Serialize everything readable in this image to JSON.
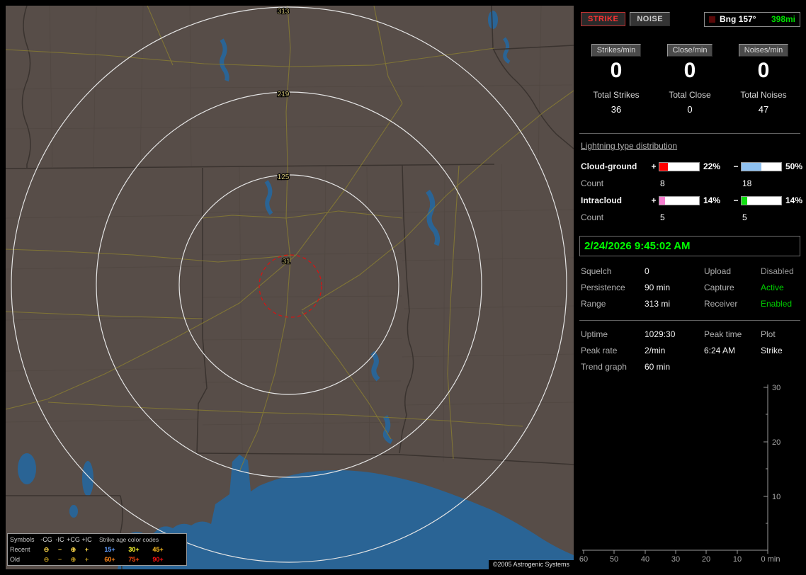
{
  "map": {
    "ring_labels": [
      "313",
      "219",
      "125",
      "31"
    ],
    "copyright": "©2005 Astrogenic Systems",
    "legend": {
      "symbols_title": "Symbols",
      "polarity_headers": [
        "-CG",
        "-IC",
        "+CG",
        "+IC"
      ],
      "age_title": "Strike age color codes",
      "recent_label": "Recent",
      "old_label": "Old",
      "recent_symbols": [
        "⊖",
        "−",
        "⊕",
        "+"
      ],
      "old_symbols": [
        "⊖",
        "−",
        "⊕",
        "+"
      ],
      "recent_symbol_color": "#ffd94a",
      "old_symbol_color": "#b08f1e",
      "recent_ages": [
        {
          "text": "15+",
          "color": "#5f9dff"
        },
        {
          "text": "30+",
          "color": "#ffff30"
        },
        {
          "text": "45+",
          "color": "#ffc020"
        }
      ],
      "old_ages": [
        {
          "text": "60+",
          "color": "#ff8518"
        },
        {
          "text": "75+",
          "color": "#ff4a10"
        },
        {
          "text": "90+",
          "color": "#ff1010"
        }
      ]
    }
  },
  "panel": {
    "strike_button": "STRIKE",
    "noise_button": "NOISE",
    "strike_color": "#ff3232",
    "bearing": {
      "label": "Bng 157°",
      "value": "398mi",
      "value_color": "#00e000"
    },
    "rates": [
      {
        "label": "Strikes/min",
        "value": "0"
      },
      {
        "label": "Close/min",
        "value": "0"
      },
      {
        "label": "Noises/min",
        "value": "0"
      }
    ],
    "totals": [
      {
        "label": "Total Strikes",
        "value": "36"
      },
      {
        "label": "Total Close",
        "value": "0"
      },
      {
        "label": "Total Noises",
        "value": "47"
      }
    ],
    "distribution": {
      "title": "Lightning type distribution",
      "count_label": "Count",
      "rows": [
        {
          "label": "Cloud-ground",
          "plus": {
            "sign": "+",
            "pct": "22%",
            "fill": 22,
            "color": "#ff0000",
            "count": "8"
          },
          "minus": {
            "sign": "−",
            "pct": "50%",
            "fill": 50,
            "color": "#8fc1f0",
            "count": "18"
          }
        },
        {
          "label": "Intracloud",
          "plus": {
            "sign": "+",
            "pct": "14%",
            "fill": 14,
            "color": "#f77fd0",
            "count": "5"
          },
          "minus": {
            "sign": "−",
            "pct": "14%",
            "fill": 14,
            "color": "#10e010",
            "count": "5"
          }
        }
      ]
    },
    "datetime": {
      "text": "2/24/2026 9:45:02 AM",
      "color": "#00ff00"
    },
    "settings": [
      {
        "label": "Squelch",
        "value": "0",
        "label2": "Upload",
        "value2": "Disabled",
        "value2_color": "#9a9a9a"
      },
      {
        "label": "Persistence",
        "value": "90 min",
        "label2": "Capture",
        "value2": "Active",
        "value2_color": "#00d000"
      },
      {
        "label": "Range",
        "value": "313 mi",
        "label2": "Receiver",
        "value2": "Enabled",
        "value2_color": "#00d000"
      }
    ],
    "stats": {
      "uptime_label": "Uptime",
      "uptime_value": "1029:30",
      "peak_time_label": "Peak time",
      "plot_label": "Plot",
      "peak_rate_label": "Peak rate",
      "peak_rate_value": "2/min",
      "peak_time_value": "6:24 AM",
      "plot_value": "Strike",
      "trend_label": "Trend graph",
      "trend_value": "60 min"
    }
  },
  "chart_data": {
    "type": "line",
    "title": "Trend graph",
    "xlabel": "min",
    "ylabel": "",
    "x_ticks": [
      60,
      50,
      40,
      30,
      20,
      10,
      0
    ],
    "x_tick_labels": [
      "60",
      "50",
      "40",
      "30",
      "20",
      "10",
      "0 min"
    ],
    "y_ticks": [
      10,
      20,
      30
    ],
    "y_tick_labels": [
      "30",
      "20",
      "10"
    ],
    "ylim": [
      0,
      30
    ],
    "x_axis_reversed": true,
    "grid": false,
    "legend_position": "none",
    "series": [
      {
        "name": "Strike",
        "x": [],
        "values": []
      }
    ]
  }
}
